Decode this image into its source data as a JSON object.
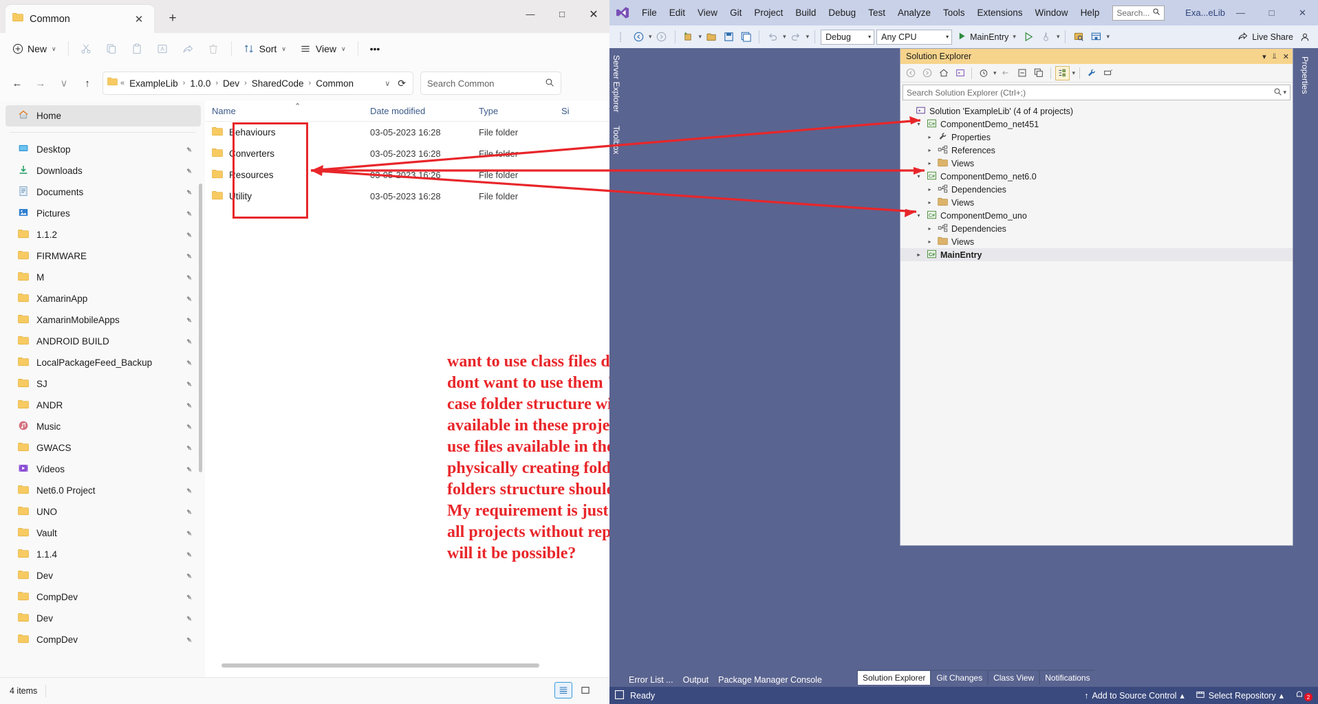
{
  "explorer": {
    "tab": {
      "label": "Common",
      "close": "✕",
      "new_tab": "+"
    },
    "window_controls": {
      "minimize": "—",
      "maximize": "□",
      "close": "✕"
    },
    "toolbar": {
      "new_label": "New",
      "sort_label": "Sort",
      "view_label": "View",
      "more_label": "•••",
      "chevron": "∨",
      "icons": [
        "cut-icon",
        "copy-icon",
        "paste-icon",
        "rename-icon",
        "share-icon",
        "delete-icon"
      ]
    },
    "address": {
      "back": "←",
      "forward": "→",
      "recent": "∨",
      "up": "↑",
      "overflow": "«",
      "crumbs": [
        "ExampleLib",
        "1.0.0",
        "Dev",
        "SharedCode",
        "Common"
      ],
      "separator": "›",
      "dropdown": "∨",
      "refresh": "⟳"
    },
    "search": {
      "placeholder": "Search Common",
      "icon": "search-icon"
    },
    "nav": {
      "home": {
        "label": "Home",
        "icon": "home-icon"
      },
      "items": [
        {
          "label": "Desktop",
          "icon": "desktop-icon",
          "pinned": true
        },
        {
          "label": "Downloads",
          "icon": "downloads-icon",
          "pinned": true
        },
        {
          "label": "Documents",
          "icon": "documents-icon",
          "pinned": true
        },
        {
          "label": "Pictures",
          "icon": "pictures-icon",
          "pinned": true
        },
        {
          "label": "1.1.2",
          "icon": "folder-icon",
          "pinned": true
        },
        {
          "label": "FIRMWARE",
          "icon": "folder-icon",
          "pinned": true
        },
        {
          "label": "M",
          "icon": "folder-icon",
          "pinned": true
        },
        {
          "label": "XamarinApp",
          "icon": "folder-icon",
          "pinned": true
        },
        {
          "label": "XamarinMobileApps",
          "icon": "folder-icon",
          "pinned": true
        },
        {
          "label": "ANDROID BUILD",
          "icon": "folder-icon",
          "pinned": true
        },
        {
          "label": "LocalPackageFeed_Backup",
          "icon": "folder-icon",
          "pinned": true
        },
        {
          "label": "SJ",
          "icon": "folder-icon",
          "pinned": true
        },
        {
          "label": "ANDR",
          "icon": "folder-icon",
          "pinned": true
        },
        {
          "label": "Music",
          "icon": "music-icon",
          "pinned": true
        },
        {
          "label": "GWACS",
          "icon": "folder-icon",
          "pinned": true
        },
        {
          "label": "Videos",
          "icon": "videos-icon",
          "pinned": true
        },
        {
          "label": "Net6.0 Project",
          "icon": "folder-icon",
          "pinned": true
        },
        {
          "label": "UNO",
          "icon": "folder-icon",
          "pinned": true
        },
        {
          "label": "Vault",
          "icon": "folder-icon",
          "pinned": true
        },
        {
          "label": "1.1.4",
          "icon": "folder-icon",
          "pinned": true
        },
        {
          "label": "Dev",
          "icon": "folder-icon",
          "pinned": true
        },
        {
          "label": "CompDev",
          "icon": "folder-icon",
          "pinned": true
        },
        {
          "label": "Dev",
          "icon": "folder-icon",
          "pinned": true
        },
        {
          "label": "CompDev",
          "icon": "folder-icon",
          "pinned": true
        }
      ]
    },
    "columns": {
      "name": "Name",
      "date_modified": "Date modified",
      "type": "Type",
      "size": "Si",
      "sort_indicator": "⌃"
    },
    "files": [
      {
        "name": "Behaviours",
        "date": "03-05-2023 16:28",
        "type": "File folder",
        "size": ""
      },
      {
        "name": "Converters",
        "date": "03-05-2023 16:28",
        "type": "File folder",
        "size": ""
      },
      {
        "name": "Resources",
        "date": "03-05-2023 16:26",
        "type": "File folder",
        "size": ""
      },
      {
        "name": "Utility",
        "date": "03-05-2023 16:28",
        "type": "File folder",
        "size": ""
      }
    ],
    "status": {
      "item_count": "4 items"
    },
    "view_toggles": {
      "details": "details-view-icon",
      "tiles": "tiles-view-icon"
    }
  },
  "annotation": {
    "color": "#e8262a",
    "text": "want to use class files defined in these folders.I dont want to use them \"As a link\".Because in this case folder structure will not be physically available in these projects.My requirements is to use files available in these folders without physically creating folders in my project.But folders structure should be visible in my projects. My requirement is just to use same source code in all projects without replication of source files.How will it be possible?"
  },
  "vs": {
    "title": {
      "logo": "visual-studio-logo",
      "menus": [
        "File",
        "Edit",
        "View",
        "Git",
        "Project",
        "Build",
        "Debug",
        "Test",
        "Analyze",
        "Tools",
        "Extensions",
        "Window",
        "Help"
      ],
      "search_placeholder": "Search...",
      "search_icon": "search-icon",
      "doc_name": "Exa...eLib",
      "minimize": "—",
      "maximize": "□",
      "close": "✕"
    },
    "toolbar": {
      "back": "←",
      "forward": "→",
      "config": "Debug",
      "platform": "Any CPU",
      "run_target": "MainEntry",
      "run_icon": "play-icon",
      "live_share": "Live Share",
      "dropdown_arrow": "▾"
    },
    "left_rail": [
      "Server Explorer",
      "Toolbox"
    ],
    "right_rail": "Properties",
    "solution_explorer": {
      "title": "Solution Explorer",
      "header_controls": {
        "dropdown": "▾",
        "pin": "⫫",
        "close": "✕"
      },
      "search_placeholder": "Search Solution Explorer (Ctrl+;)",
      "search_icon": "search-icon",
      "tree": [
        {
          "depth": 0,
          "label": "Solution 'ExampleLib' (4 of 4 projects)",
          "icon": "solution-icon",
          "twisty": "",
          "bold": false
        },
        {
          "depth": 1,
          "label": "ComponentDemo_net451",
          "icon": "csharp-project-icon",
          "twisty": "▾",
          "bold": false
        },
        {
          "depth": 2,
          "label": "Properties",
          "icon": "properties-icon",
          "twisty": "▸",
          "bold": false
        },
        {
          "depth": 2,
          "label": "References",
          "icon": "references-icon",
          "twisty": "▸",
          "bold": false
        },
        {
          "depth": 2,
          "label": "Views",
          "icon": "folder-icon",
          "twisty": "▸",
          "bold": false
        },
        {
          "depth": 1,
          "label": "ComponentDemo_net6.0",
          "icon": "csharp-project-icon",
          "twisty": "▾",
          "bold": false
        },
        {
          "depth": 2,
          "label": "Dependencies",
          "icon": "references-icon",
          "twisty": "▸",
          "bold": false
        },
        {
          "depth": 2,
          "label": "Views",
          "icon": "folder-icon",
          "twisty": "▸",
          "bold": false
        },
        {
          "depth": 1,
          "label": "ComponentDemo_uno",
          "icon": "csharp-project-icon",
          "twisty": "▾",
          "bold": false
        },
        {
          "depth": 2,
          "label": "Dependencies",
          "icon": "references-icon",
          "twisty": "▸",
          "bold": false
        },
        {
          "depth": 2,
          "label": "Views",
          "icon": "folder-icon",
          "twisty": "▸",
          "bold": false
        },
        {
          "depth": 1,
          "label": "MainEntry",
          "icon": "csharp-project-icon",
          "twisty": "▸",
          "bold": true
        }
      ],
      "tabs": [
        {
          "label": "Solution Explorer",
          "active": true
        },
        {
          "label": "Git Changes",
          "active": false
        },
        {
          "label": "Class View",
          "active": false
        },
        {
          "label": "Notifications",
          "active": false
        }
      ]
    },
    "bottom_tabs": [
      "Error List ...",
      "Output",
      "Package Manager Console"
    ],
    "status_bar": {
      "ready": "Ready",
      "add_to_source_control": "Add to Source Control",
      "select_repository": "Select Repository",
      "notification_count": "2",
      "caret_up": "▴",
      "arrow_up": "↑"
    }
  }
}
